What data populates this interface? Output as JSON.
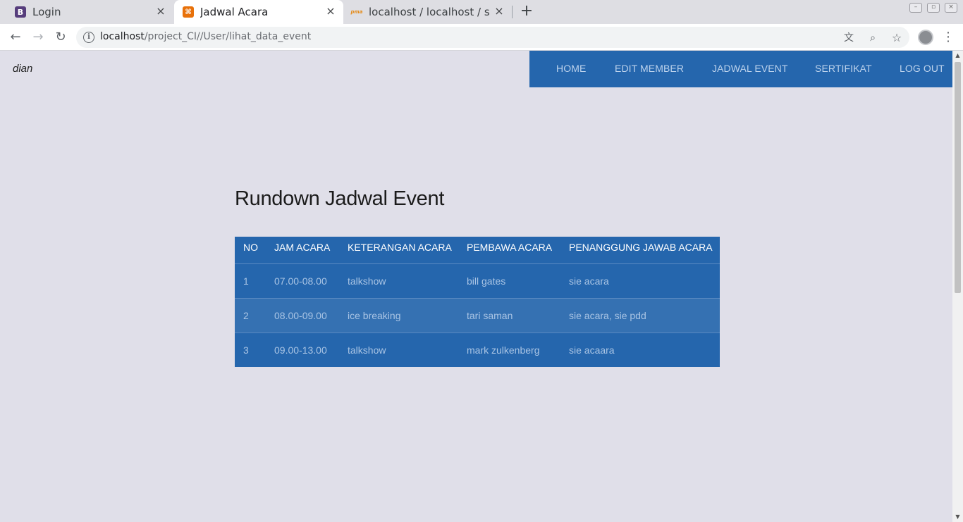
{
  "browser": {
    "tabs": [
      {
        "title": "Login",
        "favicon": "B"
      },
      {
        "title": "Jadwal Acara",
        "favicon": "⌘"
      },
      {
        "title": "localhost / localhost / ser",
        "favicon": "pma"
      }
    ],
    "url_host": "localhost",
    "url_path": "/project_CI//User/lihat_data_event",
    "icons": [
      "back-icon",
      "forward-icon",
      "reload-icon",
      "info-icon",
      "translate-icon",
      "zoom-icon",
      "star-icon",
      "profile-avatar",
      "menu-icon",
      "new-tab-icon",
      "close-tab-icon"
    ]
  },
  "brand": "dian",
  "nav": {
    "home": "HOME",
    "edit_member": "EDIT MEMBER",
    "jadwal_event": "JADWAL EVENT",
    "sertifikat": "SERTIFIKAT",
    "logout": "LOG OUT"
  },
  "heading": "Rundown Jadwal Event",
  "table": {
    "columns": [
      "NO",
      "JAM ACARA",
      "KETERANGAN ACARA",
      "PEMBAWA ACARA",
      "PENANGGUNG JAWAB ACARA"
    ],
    "rows": [
      [
        "1",
        "07.00-08.00",
        "talkshow",
        "bill gates",
        "sie acara"
      ],
      [
        "2",
        "08.00-09.00",
        "ice breaking",
        "tari saman",
        "sie acara, sie pdd"
      ],
      [
        "3",
        "09.00-13.00",
        "talkshow",
        "mark zulkenberg",
        "sie acaara"
      ]
    ]
  },
  "colors": {
    "navbar": "#2566ad",
    "table_odd": "#2566ad",
    "table_even": "#3571b2",
    "page_bg": "#e0dfe9"
  }
}
